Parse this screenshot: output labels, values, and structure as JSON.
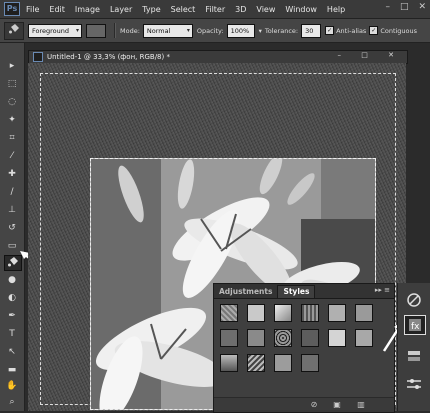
{
  "app": {
    "logo": "Ps",
    "menu": [
      "File",
      "Edit",
      "Image",
      "Layer",
      "Type",
      "Select",
      "Filter",
      "3D",
      "View",
      "Window",
      "Help"
    ],
    "window_controls": [
      "–",
      "□",
      "✕"
    ]
  },
  "options_bar": {
    "fill_source": "Foreground",
    "mode_label": "Mode:",
    "mode_value": "Normal",
    "opacity_label": "Opacity:",
    "opacity_value": "100%",
    "tolerance_label": "Tolerance:",
    "tolerance_value": "30",
    "antialias_label": "Anti-alias",
    "contiguous_label": "Contiguous"
  },
  "document": {
    "title": "Untitled-1 @ 33,3% (фон, RGB/8) *",
    "controls": [
      "–",
      "□",
      "✕"
    ]
  },
  "panel": {
    "tabs": [
      "Adjustments",
      "Styles"
    ],
    "active_tab": "Styles",
    "menu_glyphs": "▸▸ ≡"
  },
  "icons": {
    "active_tool": "paint-bucket-icon",
    "dock": [
      "adjustments-icon",
      "styles-icon",
      "layers-icon",
      "channels-icon"
    ]
  },
  "colors": {
    "ui_dark": "#2b2b2b",
    "ui_panel": "#3f3f3f",
    "accent_arrow": "#ffffff"
  }
}
